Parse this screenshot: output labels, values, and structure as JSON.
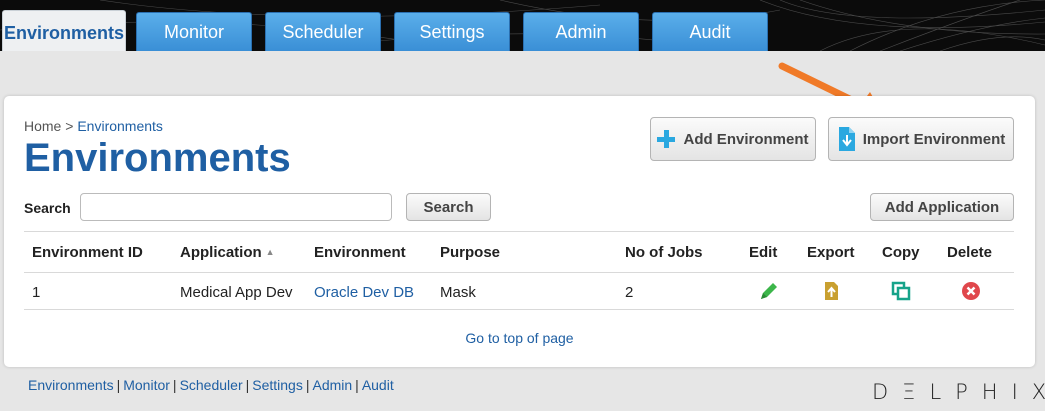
{
  "nav": {
    "tabs": [
      {
        "label": "Environments",
        "active": true
      },
      {
        "label": "Monitor",
        "active": false
      },
      {
        "label": "Scheduler",
        "active": false
      },
      {
        "label": "Settings",
        "active": false
      },
      {
        "label": "Admin",
        "active": false
      },
      {
        "label": "Audit",
        "active": false
      }
    ]
  },
  "breadcrumb": {
    "home": "Home",
    "separator": ">",
    "current": "Environments"
  },
  "page": {
    "title": "Environments"
  },
  "toolbar": {
    "add_environment": "Add Environment",
    "import_environment": "Import Environment",
    "add_application": "Add Application"
  },
  "search": {
    "label": "Search",
    "value": "",
    "button": "Search"
  },
  "table": {
    "columns": [
      "Environment ID",
      "Application",
      "Environment",
      "Purpose",
      "No of Jobs",
      "Edit",
      "Export",
      "Copy",
      "Delete"
    ],
    "rows": [
      {
        "id": "1",
        "application": "Medical App Dev",
        "environment": "Oracle Dev DB",
        "purpose": "Mask",
        "jobs": "2"
      }
    ],
    "icons": {
      "edit": "pencil-icon",
      "export": "export-icon",
      "copy": "copy-icon",
      "delete": "delete-icon"
    }
  },
  "go_to_top": "Go to top of page",
  "footer": {
    "links": [
      "Environments",
      "Monitor",
      "Scheduler",
      "Settings",
      "Admin",
      "Audit"
    ],
    "separator": "|"
  },
  "logo": {
    "text": "DΞLPHIX"
  },
  "colors": {
    "accent": "#1f5fa3",
    "tab": "#4a9fe2",
    "arrow": "#f07a28",
    "edit": "#3cb64a",
    "copy": "#16a38a",
    "delete": "#e0474c",
    "export": "#c9a030"
  }
}
